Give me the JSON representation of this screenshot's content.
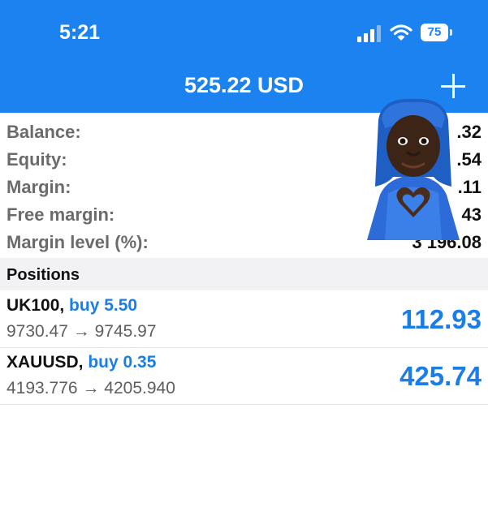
{
  "status_bar": {
    "time": "5:21",
    "battery": "75"
  },
  "header": {
    "title": "525.22 USD",
    "add_label": "+"
  },
  "summary": [
    {
      "label": "Balance:",
      "value": ".32"
    },
    {
      "label": "Equity:",
      "value": ".54"
    },
    {
      "label": "Margin:",
      "value": ".11"
    },
    {
      "label": "Free margin:",
      "value": "43"
    },
    {
      "label": "Margin level (%):",
      "value": "3 196.08"
    }
  ],
  "positions_section": {
    "title": "Positions"
  },
  "positions": [
    {
      "symbol": "UK100,",
      "side": "buy 5.50",
      "open_price": "9730.47",
      "arrow": "→",
      "current_price": "9745.97",
      "profit": "112.93"
    },
    {
      "symbol": "XAUUSD,",
      "side": "buy 0.35",
      "open_price": "4193.776",
      "arrow": "→",
      "current_price": "4205.940",
      "profit": "425.74"
    }
  ],
  "overlay": {
    "icon": "memoji-heart-hands-icon"
  },
  "colors": {
    "header_bg": "#1b82f0",
    "accent_blue": "#1b7ee8",
    "section_bg": "#f2f2f4"
  }
}
